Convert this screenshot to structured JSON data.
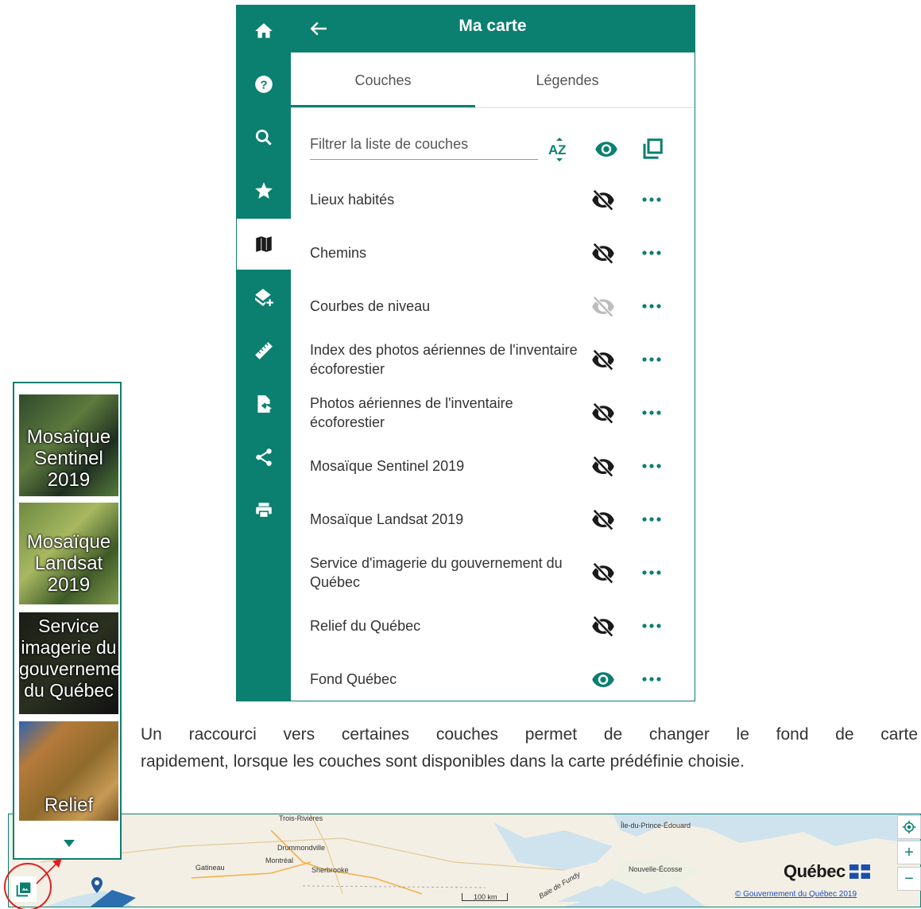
{
  "panel": {
    "title": "Ma carte",
    "tabs": [
      "Couches",
      "Légendes"
    ],
    "filter_placeholder": "Filtrer la liste de couches",
    "sidebar_icons": [
      "home-icon",
      "help-icon",
      "search-icon",
      "star-icon",
      "map-icon",
      "add-layer-icon",
      "ruler-icon",
      "export-file-icon",
      "share-icon",
      "print-icon"
    ],
    "active_sidebar_item": "map-icon",
    "layers": [
      {
        "name": "Lieux habités",
        "visible": false
      },
      {
        "name": "Chemins",
        "visible": false
      },
      {
        "name": "Courbes de niveau",
        "visible": false,
        "disabled": true
      },
      {
        "name": "Index des photos aériennes de l'inventaire écoforestier",
        "visible": false
      },
      {
        "name": "Photos aériennes de l'inventaire écoforestier",
        "visible": false
      },
      {
        "name": "Mosaïque Sentinel 2019",
        "visible": false
      },
      {
        "name": "Mosaïque Landsat 2019",
        "visible": false
      },
      {
        "name": "Service d'imagerie du gouvernement du Québec",
        "visible": false
      },
      {
        "name": "Relief du Québec",
        "visible": false
      },
      {
        "name": "Fond Québec",
        "visible": true
      }
    ],
    "accent_color": "#0b7f70"
  },
  "caption": {
    "line1": "Un raccourci vers certaines couches permet de changer le fond de carte",
    "line2": "rapidement, lorsque les couches sont disponibles dans la carte prédéfinie choisie."
  },
  "basemap_selector": {
    "thumbnails": [
      {
        "label": "Mosaïque Sentinel 2019"
      },
      {
        "label": "Mosaïque Landsat 2019"
      },
      {
        "label": "Service imagerie du gouvernement du Québec"
      },
      {
        "label": "Relief"
      }
    ]
  },
  "map": {
    "places": [
      "Trois-Rivières",
      "Drummondville",
      "Montréal",
      "Gatineau",
      "Sherbrooke",
      "Île-du-Prince-Édouard",
      "Nouvelle-Écosse",
      "Baie de Fundy"
    ],
    "scale": "100 km",
    "brand": "Québec",
    "attribution": "© Gouvernement du Québec 2019",
    "controls": [
      "+",
      "−"
    ]
  }
}
